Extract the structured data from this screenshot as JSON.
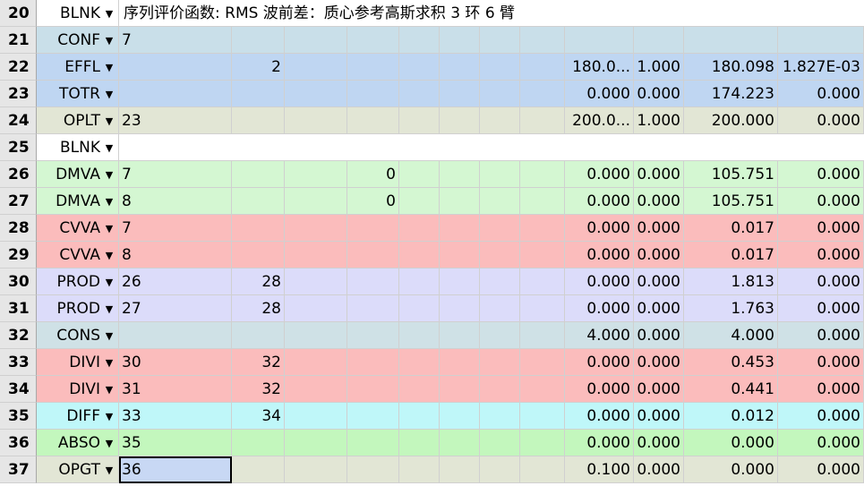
{
  "colors": {
    "BLNK": "#ffffff",
    "CONF": "#c9dfe9",
    "EFFL": "#bfd6f2",
    "TOTR": "#bfd6f2",
    "OPLT": "#e2e6d5",
    "DMVA": "#d4f7d2",
    "CVVA": "#fbbcbc",
    "PROD": "#dcdcfa",
    "CONS": "#cfe1e6",
    "DIVI": "#fbbcbc",
    "DIFF": "#bff7f9",
    "ABSO": "#c3f7bd",
    "OPGT": "#e2e6d5"
  },
  "rows": [
    {
      "num": "20",
      "op": "BLNK",
      "comment": "序列评价函数: RMS 波前差：质心参考高斯求积 3 环 6 臂"
    },
    {
      "num": "21",
      "op": "CONF",
      "cells": [
        "7",
        "",
        "",
        "",
        "",
        "",
        "",
        "",
        "",
        "",
        ""
      ]
    },
    {
      "num": "22",
      "op": "EFFL",
      "cells": [
        "",
        "2",
        "",
        "",
        "",
        "",
        "",
        "180.0...",
        "1.000",
        "180.098",
        "1.827E-03"
      ]
    },
    {
      "num": "23",
      "op": "TOTR",
      "cells": [
        "",
        "",
        "",
        "",
        "",
        "",
        "",
        "0.000",
        "0.000",
        "174.223",
        "0.000"
      ]
    },
    {
      "num": "24",
      "op": "OPLT",
      "cells": [
        "23",
        "",
        "",
        "",
        "",
        "",
        "",
        "200.0...",
        "1.000",
        "200.000",
        "0.000"
      ]
    },
    {
      "num": "25",
      "op": "BLNK",
      "comment": ""
    },
    {
      "num": "26",
      "op": "DMVA",
      "cells": [
        "7",
        "",
        "",
        "0",
        "",
        "",
        "",
        "0.000",
        "0.000",
        "105.751",
        "0.000"
      ]
    },
    {
      "num": "27",
      "op": "DMVA",
      "cells": [
        "8",
        "",
        "",
        "0",
        "",
        "",
        "",
        "0.000",
        "0.000",
        "105.751",
        "0.000"
      ]
    },
    {
      "num": "28",
      "op": "CVVA",
      "cells": [
        "7",
        "",
        "",
        "",
        "",
        "",
        "",
        "0.000",
        "0.000",
        "0.017",
        "0.000"
      ]
    },
    {
      "num": "29",
      "op": "CVVA",
      "cells": [
        "8",
        "",
        "",
        "",
        "",
        "",
        "",
        "0.000",
        "0.000",
        "0.017",
        "0.000"
      ]
    },
    {
      "num": "30",
      "op": "PROD",
      "cells": [
        "26",
        "28",
        "",
        "",
        "",
        "",
        "",
        "0.000",
        "0.000",
        "1.813",
        "0.000"
      ]
    },
    {
      "num": "31",
      "op": "PROD",
      "cells": [
        "27",
        "28",
        "",
        "",
        "",
        "",
        "",
        "0.000",
        "0.000",
        "1.763",
        "0.000"
      ]
    },
    {
      "num": "32",
      "op": "CONS",
      "cells": [
        "",
        "",
        "",
        "",
        "",
        "",
        "",
        "4.000",
        "0.000",
        "4.000",
        "0.000"
      ]
    },
    {
      "num": "33",
      "op": "DIVI",
      "cells": [
        "30",
        "32",
        "",
        "",
        "",
        "",
        "",
        "0.000",
        "0.000",
        "0.453",
        "0.000"
      ]
    },
    {
      "num": "34",
      "op": "DIVI",
      "cells": [
        "31",
        "32",
        "",
        "",
        "",
        "",
        "",
        "0.000",
        "0.000",
        "0.441",
        "0.000"
      ]
    },
    {
      "num": "35",
      "op": "DIFF",
      "cells": [
        "33",
        "34",
        "",
        "",
        "",
        "",
        "",
        "0.000",
        "0.000",
        "0.012",
        "0.000"
      ]
    },
    {
      "num": "36",
      "op": "ABSO",
      "cells": [
        "35",
        "",
        "",
        "",
        "",
        "",
        "",
        "0.000",
        "0.000",
        "0.000",
        "0.000"
      ]
    },
    {
      "num": "37",
      "op": "OPGT",
      "cells": [
        "36",
        "",
        "",
        "",
        "",
        "",
        "",
        "0.100",
        "0.000",
        "0.000",
        "0.000"
      ],
      "selected_col": 0
    }
  ],
  "dropdown_icon": "caret-down-icon"
}
